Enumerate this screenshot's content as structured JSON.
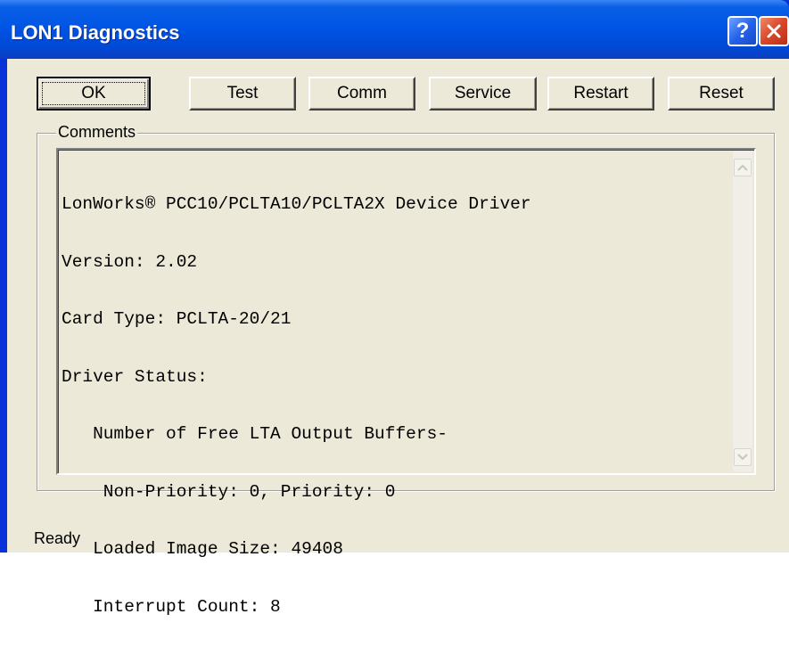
{
  "window": {
    "title": "LON1 Diagnostics",
    "help_glyph": "?",
    "colors": {
      "titlebar": "#0055e5",
      "client": "#ece9d8",
      "close_button": "#d9462a"
    }
  },
  "toolbar": {
    "buttons": [
      {
        "label": "OK"
      },
      {
        "label": "Test"
      },
      {
        "label": "Comm"
      },
      {
        "label": "Service"
      },
      {
        "label": "Restart"
      },
      {
        "label": "Reset"
      }
    ]
  },
  "comments": {
    "label": "Comments",
    "lines": [
      "LonWorks® PCC10/PCLTA10/PCLTA2X Device Driver",
      "Version: 2.02",
      "Card Type: PCLTA-20/21",
      "Driver Status:",
      "   Number of Free LTA Output Buffers-",
      "    Non-Priority: 0, Priority: 0",
      "   Loaded Image Size: 49408",
      "   Interrupt Count: 8"
    ]
  },
  "status": {
    "text": "Ready"
  },
  "icons": {
    "help": "question-mark-icon",
    "close": "close-icon",
    "scroll_up": "chevron-up-icon",
    "scroll_down": "chevron-down-icon"
  }
}
